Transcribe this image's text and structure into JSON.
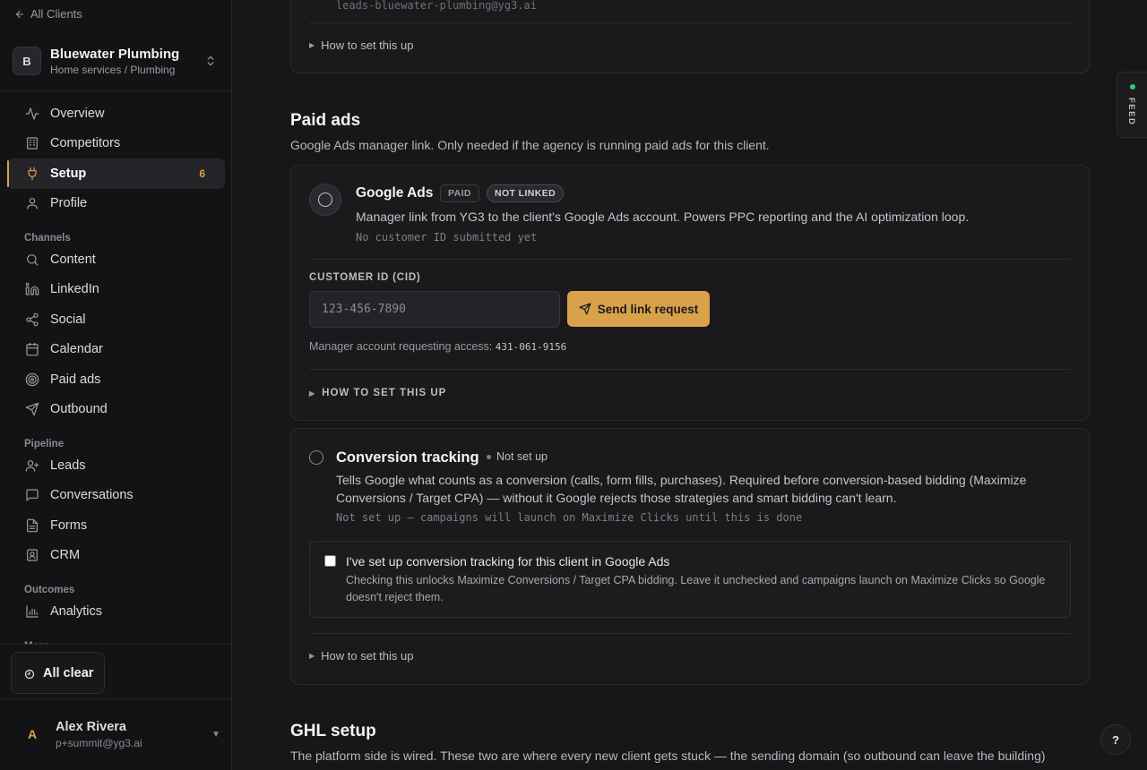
{
  "sidebar": {
    "back_label": "All Clients",
    "client": {
      "initial": "B",
      "name": "Bluewater Plumbing",
      "subtitle": "Home services / Plumbing"
    },
    "primary": [
      {
        "label": "Overview",
        "icon": "activity-icon"
      },
      {
        "label": "Competitors",
        "icon": "building-icon"
      },
      {
        "label": "Setup",
        "icon": "plug-icon",
        "badge": "6",
        "active": true
      },
      {
        "label": "Profile",
        "icon": "user-icon"
      }
    ],
    "channels_label": "Channels",
    "channels": [
      {
        "label": "Content",
        "icon": "search-icon"
      },
      {
        "label": "LinkedIn",
        "icon": "linkedin-icon"
      },
      {
        "label": "Social",
        "icon": "share-icon"
      },
      {
        "label": "Calendar",
        "icon": "calendar-icon"
      },
      {
        "label": "Paid ads",
        "icon": "target-icon"
      },
      {
        "label": "Outbound",
        "icon": "send-icon"
      }
    ],
    "pipeline_label": "Pipeline",
    "pipeline": [
      {
        "label": "Leads",
        "icon": "user-plus-icon"
      },
      {
        "label": "Conversations",
        "icon": "message-icon"
      },
      {
        "label": "Forms",
        "icon": "file-icon"
      },
      {
        "label": "CRM",
        "icon": "contact-icon"
      }
    ],
    "outcomes_label": "Outcomes",
    "outcomes": [
      {
        "label": "Analytics",
        "icon": "bar-chart-icon"
      }
    ],
    "more_label": "More",
    "all_clear_label": "All clear",
    "user": {
      "initial": "A",
      "name": "Alex Rivera",
      "email": "p+summit@yg3.ai"
    },
    "accent_color": "#d9a24a"
  },
  "top_card": {
    "faded_text": "leads-bluewater-plumbing@yg3.ai",
    "howto_label": "How to set this up"
  },
  "paid_ads": {
    "title": "Paid ads",
    "description": "Google Ads manager link. Only needed if the agency is running paid ads for this client.",
    "google_ads": {
      "title": "Google Ads",
      "tag_paid": "PAID",
      "tag_status": "NOT LINKED",
      "description": "Manager link from YG3 to the client's Google Ads account. Powers PPC reporting and the AI optimization loop.",
      "sub": "No customer ID submitted yet",
      "field_label": "CUSTOMER ID (CID)",
      "input_value": "",
      "input_placeholder": "123-456-7890",
      "button_label": "Send link request",
      "manager_prefix": "Manager account requesting access:",
      "manager_id": "431-061-9156",
      "howto_label": "HOW TO SET THIS UP"
    },
    "conversion": {
      "title": "Conversion tracking",
      "status": "Not set up",
      "description": "Tells Google what counts as a conversion (calls, form fills, purchases). Required before conversion-based bidding (Maximize Conversions / Target CPA) — without it Google rejects those strategies and smart bidding can't learn.",
      "sub": "Not set up — campaigns will launch on Maximize Clicks until this is done",
      "checkbox_label": "I've set up conversion tracking for this client in Google Ads",
      "checkbox_desc": "Checking this unlocks Maximize Conversions / Target CPA bidding. Leave it unchecked and campaigns launch on Maximize Clicks so Google doesn't reject them.",
      "howto_label": "How to set this up"
    }
  },
  "ghl": {
    "title": "GHL setup",
    "description": "The platform side is wired. These two are where every new client gets stuck — the sending domain (so outbound can leave the building)"
  },
  "feed_label": "FEED",
  "help_label": "?"
}
